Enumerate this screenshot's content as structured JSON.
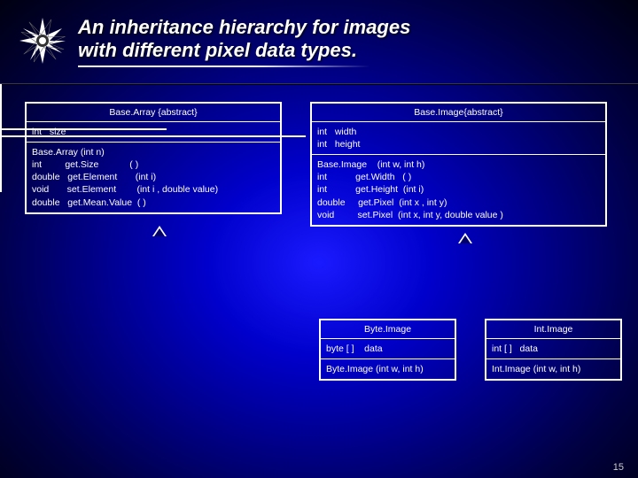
{
  "header": {
    "title_line1": "An inheritance hierarchy for images",
    "title_line2": "with different pixel data types."
  },
  "classes": {
    "basearray": {
      "title": "Base.Array {abstract}",
      "attrs": "int   size",
      "methods": "Base.Array (int n)\nint         get.Size            ( )\ndouble   get.Element       (int i)\nvoid       set.Element        (int i , double value)\ndouble   get.Mean.Value  ( )"
    },
    "baseimage": {
      "title": "Base.Image{abstract}",
      "attrs": "int   width\nint   height",
      "methods": "Base.Image    (int w, int h)\nint           get.Width   ( )\nint           get.Height  (int i)\ndouble     get.Pixel  (int x , int y)\nvoid         set.Pixel  (int x, int y, double value )"
    },
    "byteimage": {
      "title": "Byte.Image",
      "attrs": "byte [ ]    data",
      "methods": "Byte.Image (int w, int h)"
    },
    "intimage": {
      "title": "Int.Image",
      "attrs": "int [ ]   data",
      "methods": "Int.Image (int w, int h)"
    }
  },
  "page_number": "15"
}
